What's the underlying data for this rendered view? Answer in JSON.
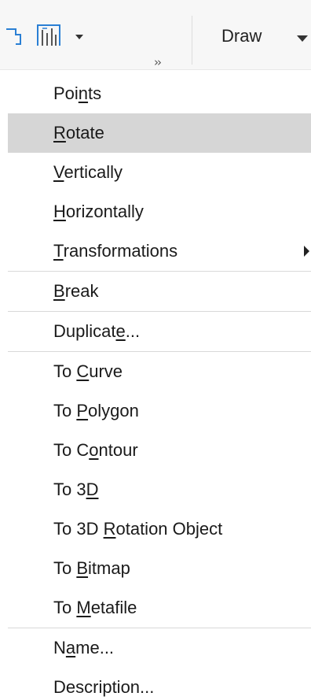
{
  "toolbar": {
    "overflow_label": "››",
    "draw_label": "Draw"
  },
  "menu": {
    "items": [
      {
        "label": "Points",
        "pre": "Poi",
        "key": "n",
        "post": "ts"
      },
      {
        "label": "Rotate",
        "pre": "",
        "key": "R",
        "post": "otate",
        "highlighted": true
      },
      {
        "label": "Vertically",
        "pre": "",
        "key": "V",
        "post": "ertically"
      },
      {
        "label": "Horizontally",
        "pre": "",
        "key": "H",
        "post": "orizontally"
      },
      {
        "label": "Transformations",
        "pre": "",
        "key": "T",
        "post": "ransformations",
        "has_submenu": true
      },
      {
        "label": "Break",
        "pre": "",
        "key": "B",
        "post": "reak"
      },
      {
        "label": "Duplicate...",
        "pre": "Duplicat",
        "key": "e",
        "post": "..."
      },
      {
        "label": "To Curve",
        "pre": "To ",
        "key": "C",
        "post": "urve"
      },
      {
        "label": "To Polygon",
        "pre": "To ",
        "key": "P",
        "post": "olygon"
      },
      {
        "label": "To Contour",
        "pre": "To C",
        "key": "o",
        "post": "ntour"
      },
      {
        "label": "To 3D",
        "pre": "To 3",
        "key": "D",
        "post": ""
      },
      {
        "label": "To 3D Rotation Object",
        "pre": "To 3D ",
        "key": "R",
        "post": "otation Object"
      },
      {
        "label": "To Bitmap",
        "pre": "To ",
        "key": "B",
        "post": "itmap"
      },
      {
        "label": "To Metafile",
        "pre": "To ",
        "key": "M",
        "post": "etafile"
      },
      {
        "label": "Name...",
        "pre": "N",
        "key": "a",
        "post": "me..."
      },
      {
        "label": "Description...",
        "pre": "Description...",
        "key": "",
        "post": ""
      }
    ]
  },
  "colors": {
    "highlight": "#d6d6d6",
    "separator": "#d9d9d9",
    "icon_blue": "#2a7fd4"
  }
}
